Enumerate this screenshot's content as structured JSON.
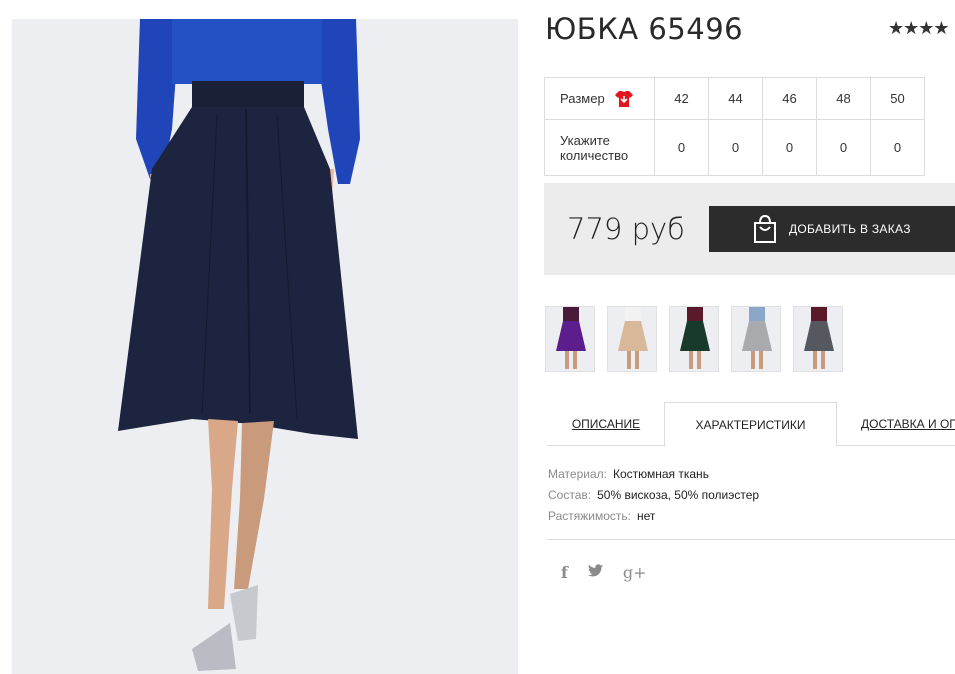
{
  "product": {
    "title": "ЮБКА 65496",
    "rating_stars": "★★★★"
  },
  "size_table": {
    "size_label": "Размер",
    "qty_label_line1": "Укажите",
    "qty_label_line2": "количество",
    "sizes": [
      "42",
      "44",
      "46",
      "48",
      "50"
    ],
    "quantities": [
      "0",
      "0",
      "0",
      "0",
      "0"
    ]
  },
  "purchase": {
    "price": "779 руб",
    "add_button_label": "ДОБАВИТЬ В ЗАКАЗ"
  },
  "thumbnails": [
    {
      "color_name": "purple",
      "skirt_color": "#5b1e8c",
      "top_color": "#4a1a3a"
    },
    {
      "color_name": "beige",
      "skirt_color": "#d8b899",
      "top_color": "#f2f2f2"
    },
    {
      "color_name": "green",
      "skirt_color": "#173a2a",
      "top_color": "#5a1a2a"
    },
    {
      "color_name": "grey",
      "skirt_color": "#a9aaae",
      "top_color": "#8aa6c8"
    },
    {
      "color_name": "dark-grey",
      "skirt_color": "#55585f",
      "top_color": "#5a1a2a"
    }
  ],
  "tabs": {
    "description": "ОПИСАНИЕ",
    "characteristics": "ХАРАКТЕРИСТИКИ",
    "delivery": "ДОСТАВКА И ОПЛАТА"
  },
  "characteristics": {
    "material_key": "Материал:",
    "material_val": "Костюмная ткань",
    "composition_key": "Состав:",
    "composition_val": "50% вискоза, 50% полиэстер",
    "stretch_key": "Растяжимость:",
    "stretch_val": "нет"
  },
  "social": {
    "facebook_glyph": "f",
    "google_glyph": "g+"
  },
  "colors": {
    "button_bg": "#2c2c2c",
    "price_box_bg": "#ececec",
    "main_skirt": "#1c2440",
    "main_top": "#1f45b8"
  }
}
